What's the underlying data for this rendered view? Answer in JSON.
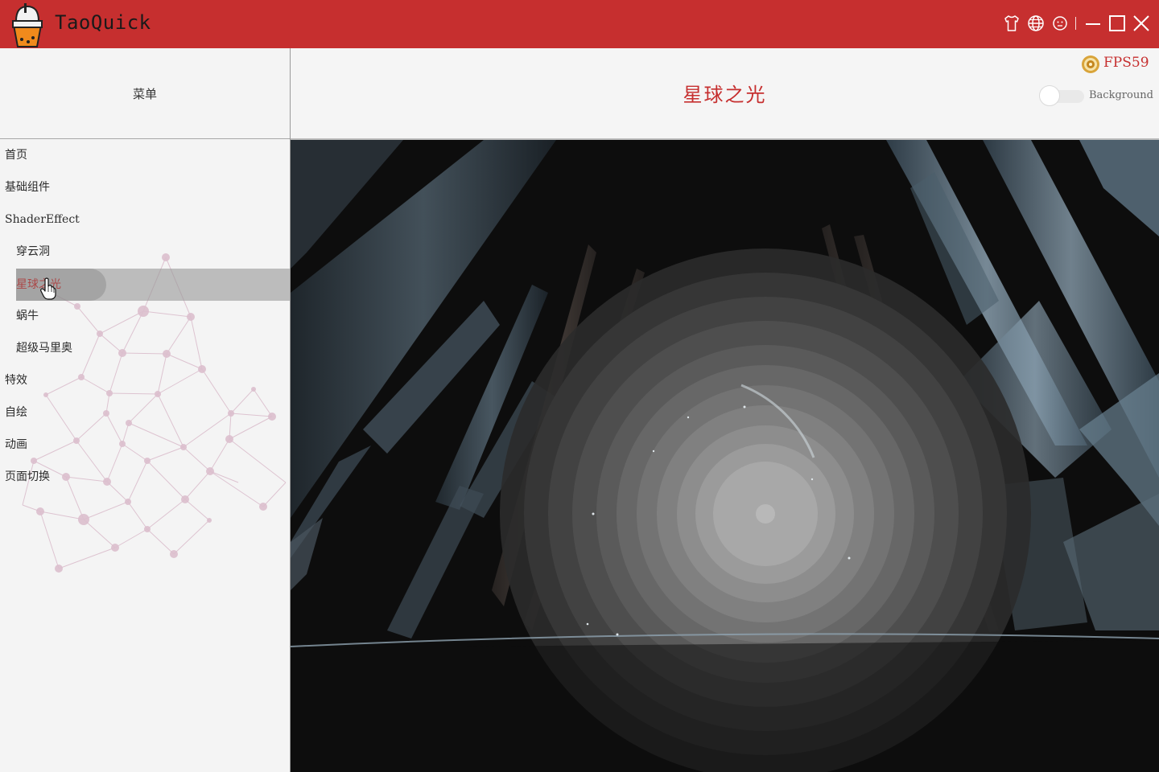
{
  "app": {
    "title": "TaoQuick",
    "icons": [
      "skin-icon",
      "language-icon",
      "about-icon",
      "minimize-icon",
      "maximize-icon",
      "close-icon"
    ]
  },
  "sidebar": {
    "menu_title": "菜单",
    "items": [
      {
        "label": "首页",
        "indent": 0
      },
      {
        "label": "基础组件",
        "indent": 0
      },
      {
        "label": "ShaderEffect",
        "indent": 0
      },
      {
        "label": "穿云洞",
        "indent": 1
      },
      {
        "label": "星球之光",
        "indent": 1,
        "selected": true
      },
      {
        "label": "蜗牛",
        "indent": 1
      },
      {
        "label": "超级马里奥",
        "indent": 1
      },
      {
        "label": "特效",
        "indent": 0
      },
      {
        "label": "自绘",
        "indent": 0
      },
      {
        "label": "动画",
        "indent": 0
      },
      {
        "label": "页面切换",
        "indent": 0
      }
    ]
  },
  "header": {
    "page_title": "星球之光",
    "fps_label": "FPS59",
    "background_toggle": {
      "label": "Background",
      "checked": false
    }
  },
  "colors": {
    "accent": "#c62f2f",
    "titlebar": "#c62f2f",
    "sidebar_bg": "#f4f4f4",
    "shader_bg": "#0d0d0d"
  }
}
